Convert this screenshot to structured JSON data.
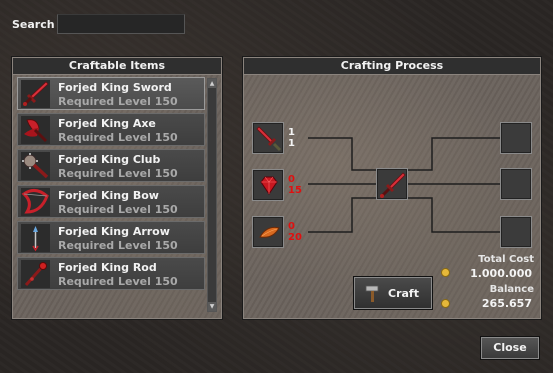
{
  "search": {
    "label": "Search",
    "value": ""
  },
  "craftable": {
    "title": "Craftable Items",
    "items": [
      {
        "name": "Forjed King Sword",
        "requirement": "Required Level 150",
        "icon": "sword-icon"
      },
      {
        "name": "Forjed King Axe",
        "requirement": "Required Level 150",
        "icon": "axe-icon"
      },
      {
        "name": "Forjed King Club",
        "requirement": "Required Level 150",
        "icon": "club-icon"
      },
      {
        "name": "Forjed King Bow",
        "requirement": "Required Level 150",
        "icon": "bow-icon"
      },
      {
        "name": "Forjed King Arrow",
        "requirement": "Required Level 150",
        "icon": "arrow-icon"
      },
      {
        "name": "Forjed King Rod",
        "requirement": "Required Level 150",
        "icon": "rod-icon"
      }
    ]
  },
  "process": {
    "title": "Crafting Process",
    "ingredients": [
      {
        "icon": "sword-icon",
        "have": "1",
        "need": "1",
        "status": "ok"
      },
      {
        "icon": "ruby-icon",
        "have": "0",
        "need": "15",
        "status": "missing"
      },
      {
        "icon": "leaf-icon",
        "have": "0",
        "need": "20",
        "status": "missing"
      }
    ],
    "result_icon": "sword-icon",
    "total_cost_label": "Total Cost",
    "total_cost": "1.000.000",
    "balance_label": "Balance",
    "balance": "265.657",
    "craft_label": "Craft"
  },
  "close_label": "Close",
  "colors": {
    "ok": "#f4f4f4",
    "missing": "#e01010",
    "coin": "#e5b83a"
  }
}
